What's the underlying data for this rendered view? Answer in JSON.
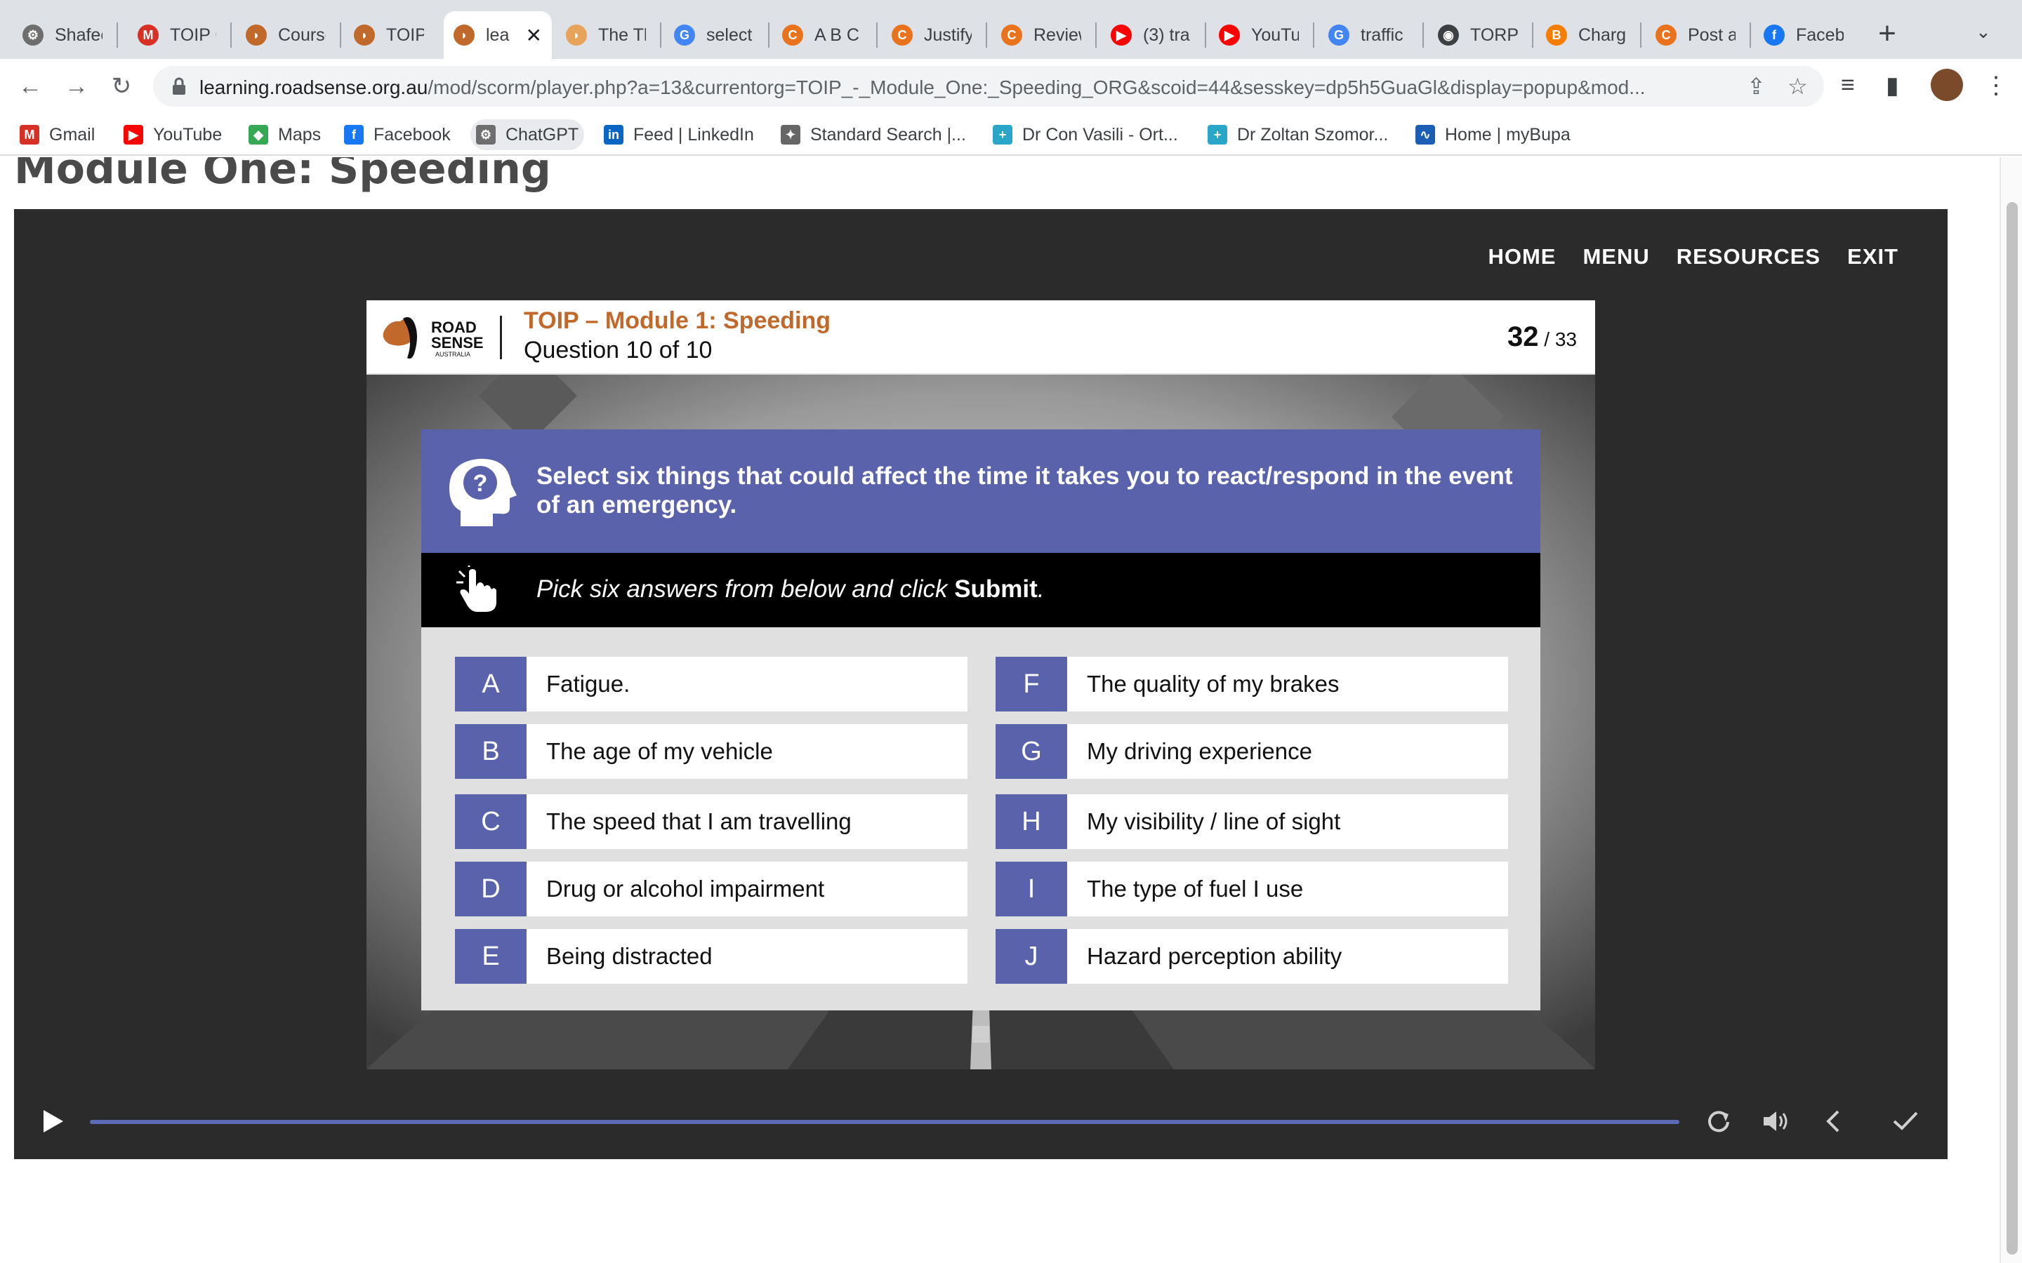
{
  "browser": {
    "tabs": [
      {
        "title": "Shafee",
        "icon": "chatgpt-icon",
        "color": "#6e6e6e"
      },
      {
        "title": "TOIP C",
        "icon": "gmail-icon",
        "color": "#d93025"
      },
      {
        "title": "Course",
        "icon": "roadsense-icon",
        "color": "#c0692a"
      },
      {
        "title": "TOIP J",
        "icon": "roadsense-icon",
        "color": "#c0692a"
      },
      {
        "title": "lea",
        "icon": "roadsense-icon",
        "color": "#c0692a",
        "active": true
      },
      {
        "title": "The Th",
        "icon": "roadsense-icon",
        "color": "#e8a35a"
      },
      {
        "title": "select",
        "icon": "google-icon",
        "color": "#4285f4"
      },
      {
        "title": "A B C",
        "icon": "c-icon",
        "color": "#e8731c"
      },
      {
        "title": "Justify",
        "icon": "c-icon",
        "color": "#e8731c"
      },
      {
        "title": "Review",
        "icon": "c-icon",
        "color": "#e8731c"
      },
      {
        "title": "(3) tra",
        "icon": "youtube-icon",
        "color": "#ff0000"
      },
      {
        "title": "YouTub",
        "icon": "youtube-icon",
        "color": "#ff0000"
      },
      {
        "title": "traffic",
        "icon": "google-icon",
        "color": "#4285f4"
      },
      {
        "title": "TORP",
        "icon": "globe-icon",
        "color": "#3c4043"
      },
      {
        "title": "Charge",
        "icon": "blogger-icon",
        "color": "#f57d00"
      },
      {
        "title": "Post a",
        "icon": "c-icon",
        "color": "#e8731c"
      },
      {
        "title": "Facebo",
        "icon": "facebook-icon",
        "color": "#1877f2"
      }
    ],
    "url_host": "learning.roadsense.org.au",
    "url_path": "/mod/scorm/player.php?a=13&currentorg=TOIP_-_Module_One:_Speeding_ORG&scoid=44&sesskey=dp5h5GuaGl&display=popup&mod...",
    "bookmarks": [
      {
        "label": "Gmail",
        "icon": "gmail-icon",
        "color": "#d93025"
      },
      {
        "label": "YouTube",
        "icon": "youtube-icon",
        "color": "#ff0000"
      },
      {
        "label": "Maps",
        "icon": "maps-icon",
        "color": "#34a853"
      },
      {
        "label": "Facebook",
        "icon": "facebook-icon",
        "color": "#1877f2"
      },
      {
        "label": "ChatGPT",
        "icon": "chatgpt-icon",
        "color": "#6e6e6e"
      },
      {
        "label": "Feed | LinkedIn",
        "icon": "linkedin-icon",
        "color": "#0a66c2"
      },
      {
        "label": "Standard Search |...",
        "icon": "crest-icon",
        "color": "#666666"
      },
      {
        "label": "Dr Con Vasili - Ort...",
        "icon": "plus-icon",
        "color": "#2aa6c9"
      },
      {
        "label": "Dr Zoltan Szomor...",
        "icon": "plus-icon",
        "color": "#2aa6c9"
      },
      {
        "label": "Home | myBupa",
        "icon": "pulse-icon",
        "color": "#1a5fb4"
      }
    ]
  },
  "page": {
    "title": "Module One: Speeding",
    "nav": [
      "HOME",
      "MENU",
      "RESOURCES",
      "EXIT"
    ]
  },
  "slide": {
    "logo_text": [
      "ROAD",
      "SENSE",
      "AUSTRALIA"
    ],
    "course_title": "TOIP – Module 1: Speeding",
    "question_count": "Question 10 of 10",
    "page_current": "32",
    "page_total": "/ 33",
    "question": "Select six things that could affect the time it takes you to react/respond  in the event of an emergency.",
    "instruction": "Pick six answers from below and click",
    "instruction_bold": "Submit",
    "instruction_end": ".",
    "answers": [
      {
        "letter": "A",
        "text": "Fatigue."
      },
      {
        "letter": "B",
        "text": "The age of my vehicle"
      },
      {
        "letter": "C",
        "text": "The speed that I am travelling"
      },
      {
        "letter": "D",
        "text": "Drug or alcohol impairment"
      },
      {
        "letter": "E",
        "text": "Being distracted"
      },
      {
        "letter": "F",
        "text": "The quality of my brakes"
      },
      {
        "letter": "G",
        "text": "My driving experience"
      },
      {
        "letter": "H",
        "text": "My visibility / line of sight"
      },
      {
        "letter": "I",
        "text": "The type of fuel I use"
      },
      {
        "letter": "J",
        "text": "Hazard perception ability"
      }
    ],
    "colors": {
      "accent": "#5b62ac",
      "brand": "#c0692a"
    }
  },
  "controls": {
    "progress": 1.0
  }
}
